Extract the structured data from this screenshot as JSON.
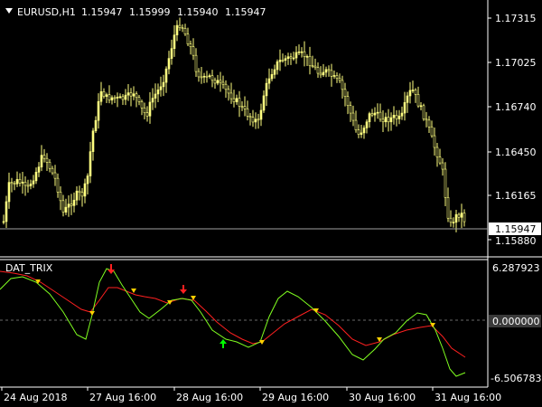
{
  "header": {
    "symbol": "EURUSD,H1",
    "open": "1.15947",
    "high": "1.15999",
    "low": "1.15940",
    "close": "1.15947"
  },
  "colors": {
    "background": "#000000",
    "candle": "#ffff80",
    "grid": "#5a5a5a",
    "axis_text": "#ffffff",
    "trix_main": "#80ff20",
    "trix_signal": "#ff2020",
    "cross_marker": "#ffd000",
    "arrow_up": "#00ff00",
    "arrow_down": "#ff2020"
  },
  "price_axis": {
    "labels": [
      "1.17315",
      "1.17025",
      "1.16740",
      "1.16450",
      "1.16165",
      "1.15880"
    ],
    "current_price": "1.15947"
  },
  "indicator": {
    "name": "DAT_TRIX",
    "axis_labels": [
      "6.287923",
      "0.000000",
      "-6.506783"
    ]
  },
  "time_axis": {
    "labels": [
      "24 Aug 2018",
      "27 Aug 16:00",
      "28 Aug 16:00",
      "29 Aug 16:00",
      "30 Aug 16:00",
      "31 Aug 16:00"
    ]
  }
}
